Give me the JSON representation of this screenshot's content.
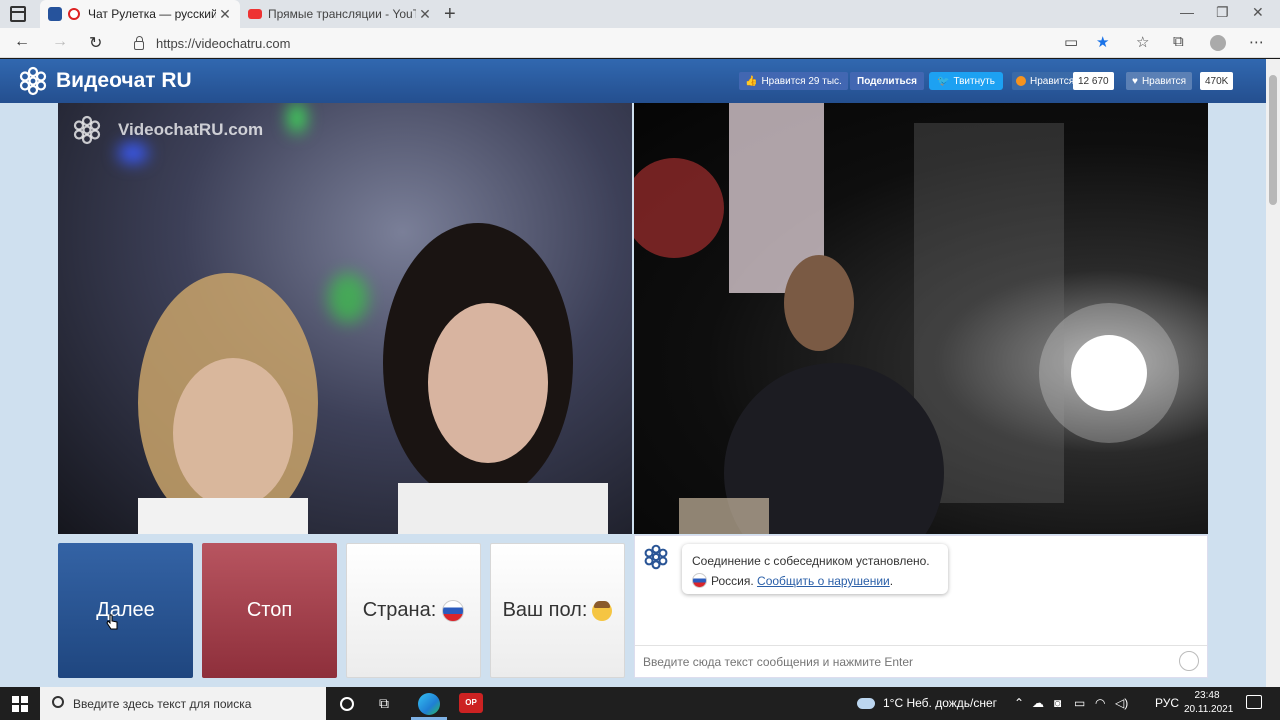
{
  "browser": {
    "tabs": [
      {
        "title": "Чат Рулетка — русский ви",
        "active": true
      },
      {
        "title": "Прямые трансляции - YouTube",
        "active": false
      }
    ],
    "url": "https://videochatru.com"
  },
  "header": {
    "logo_text": "Видеочат RU",
    "fb_like": "Нравится 29 тыс.",
    "fb_share": "Поделиться",
    "twitter": "Твитнуть",
    "ok_like": "Нравится",
    "ok_count": "12 670",
    "vk_like": "Нравится",
    "vk_count": "470K"
  },
  "video": {
    "watermark": "VideochatRU.com"
  },
  "controls": {
    "next": "Далее",
    "stop": "Стоп",
    "country": "Страна:",
    "gender": "Ваш пол:"
  },
  "chat": {
    "message_line1": "Соединение с собеседником установлено.",
    "country": "Россия.",
    "report_link": "Сообщить о нарушении",
    "report_suffix": ".",
    "input_placeholder": "Введите сюда текст сообщения и нажмите Enter"
  },
  "taskbar": {
    "search_placeholder": "Введите здесь текст для поиска",
    "weather": "1°C  Неб. дождь/снег",
    "lang": "РУС",
    "time": "23:48",
    "date": "20.11.2021",
    "opera_label": "OP"
  },
  "colors": {
    "header_blue": "#2b5ea3",
    "next_button": "#2a5596",
    "stop_button": "#a3424d",
    "page_bg": "#cfe0ef"
  }
}
